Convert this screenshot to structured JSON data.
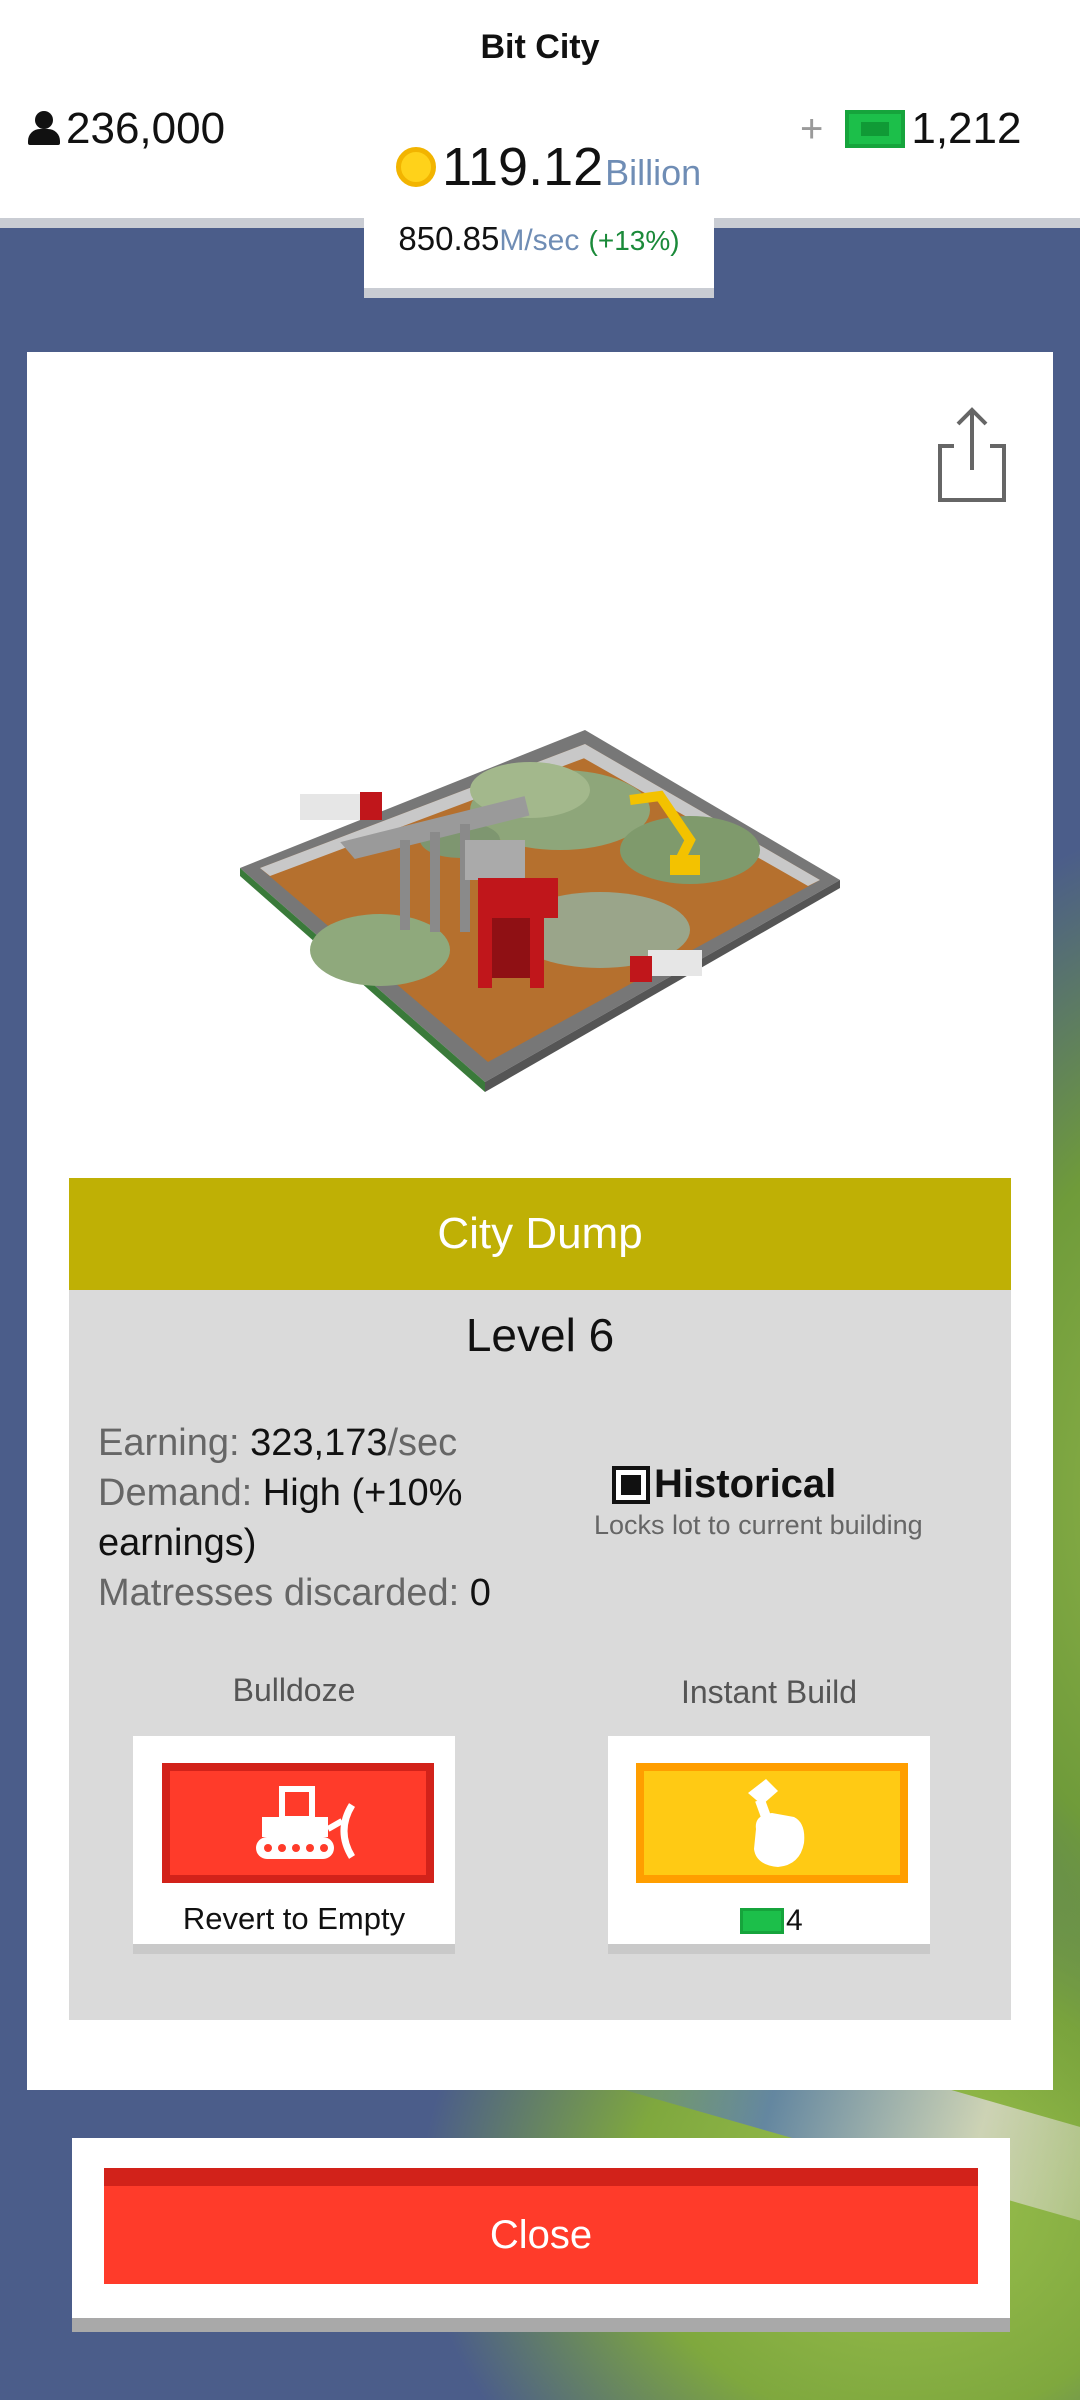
{
  "app": {
    "title": "Bit City"
  },
  "header": {
    "population": "236,000",
    "coins_value": "119.12",
    "coins_unit": "Billion",
    "rate_value": "850.85",
    "rate_unit": "M/sec",
    "rate_change": "(+13%)",
    "plus": "+",
    "cash": "1,212"
  },
  "building": {
    "name": "City Dump",
    "level": "Level 6",
    "earning_label": "Earning:",
    "earning_value": "323,173",
    "earning_unit": "/sec",
    "demand_label": "Demand:",
    "demand_value": "High (+10% earnings)",
    "matresses_label": "Matresses discarded:",
    "matresses_value": "0",
    "historical_label": "Historical",
    "historical_desc": "Locks lot to current building",
    "historical_checked": true
  },
  "actions": {
    "bulldoze_label": "Bulldoze",
    "revert_text": "Revert to Empty",
    "instant_build_label": "Instant Build",
    "instant_build_cost": "4"
  },
  "footer": {
    "close_label": "Close"
  },
  "colors": {
    "banner": "#bfb005",
    "red_button": "#ff3b2a",
    "yellow_button": "#ffca14",
    "cash_green": "#1cbf4a",
    "coin_gold": "#ffd21a",
    "background": "#4b5d8a"
  },
  "icons": {
    "population": "person-icon",
    "coins": "coin-icon",
    "cash": "bill-icon",
    "share": "share-icon",
    "bulldoze": "bulldozer-icon",
    "instant_build": "hammer-hand-icon"
  }
}
